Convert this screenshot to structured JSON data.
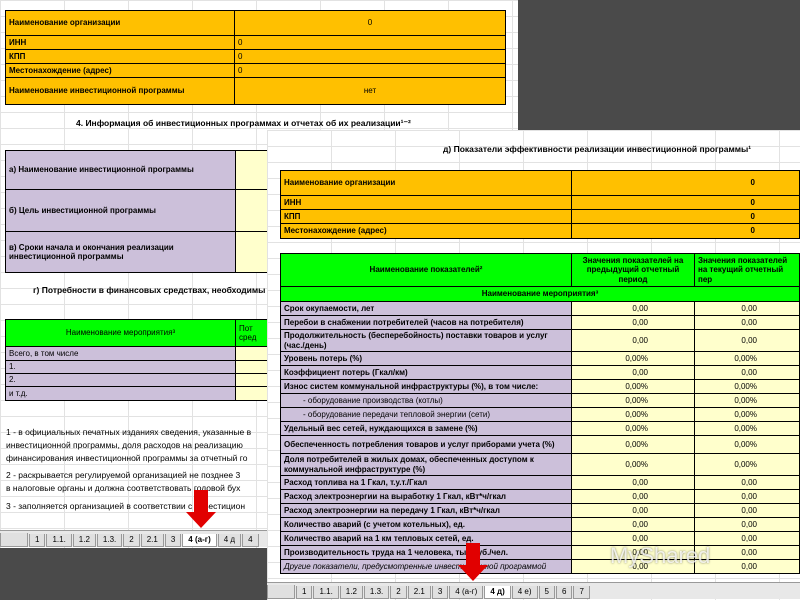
{
  "back": {
    "org_rows": [
      {
        "label": "Наименование организации",
        "value": "0"
      },
      {
        "label": "ИНН",
        "value": "0"
      },
      {
        "label": "КПП",
        "value": "0"
      },
      {
        "label": "Местонахождение (адрес)",
        "value": "0"
      },
      {
        "label": "Наименование инвестиционной программы",
        "value": "нет"
      }
    ],
    "section4_title": "4. Информация об инвестиционных программах и отчетах об их реализации¹⁻²",
    "items": [
      "а) Наименование инвестиционной программы",
      "б) Цель инвестиционной программы",
      "в) Сроки начала и окончания реализации инвестиционной программы"
    ],
    "needs_title": "г) Потребности в финансовых средствах, необходимы",
    "fin_header": "Наименование мероприятия³",
    "fin_header2": "Пот",
    "fin_header3": "сред",
    "fin_rows": [
      "Всего, в том числе",
      "1.",
      "2.",
      "и т.д."
    ],
    "notes": [
      "1 - в официальных печатных изданиях сведения, указанные в",
      "инвестиционной программы, доля расходов на реализацию",
      "финансирования инвестиционной программы за отчетный го",
      "2 - раскрывается регулируемой организацией не позднее 3",
      "в налоговые органы и должна соответствовать годовой бух",
      "3 - заполняется организацией в соответствии с инвестицион"
    ],
    "tabs": [
      "1",
      "1.1.",
      "1.2",
      "1.3.",
      "2",
      "2.1",
      "3",
      "4 (а-г)",
      "4 д",
      "4"
    ],
    "active_tab": "4 (а-г)"
  },
  "front": {
    "title": "д) Показатели эффективности реализации инвестиционной программы¹",
    "org_rows": [
      {
        "label": "Наименование организации",
        "value": "0"
      },
      {
        "label": "ИНН",
        "value": "0"
      },
      {
        "label": "КПП",
        "value": "0"
      },
      {
        "label": "Местонахождение (адрес)",
        "value": "0"
      }
    ],
    "table_headers": [
      "Наименование показателей²",
      "Значения показателей на предыдущий отчетный период",
      "Значения показателей на текущий отчетный пер"
    ],
    "measure_header": "Наименование мероприятия³",
    "rows": [
      {
        "label": "Срок окупаемости, лет",
        "v1": "0,00",
        "v2": "0,00"
      },
      {
        "label": "Перебои в снабжении потребителей (часов на потребителя)",
        "v1": "0,00",
        "v2": "0,00"
      },
      {
        "label": "Продолжительность (бесперебойность) поставки товаров и услуг (час./день)",
        "v1": "0,00",
        "v2": "0,00"
      },
      {
        "label": "Уровень потерь (%)",
        "v1": "0,00%",
        "v2": "0,00%"
      },
      {
        "label": "Коэффициент потерь (Гкал/км)",
        "v1": "0,00",
        "v2": "0,00"
      },
      {
        "label": "Износ систем коммунальной инфраструктуры (%), в том числе:",
        "v1": "0,00%",
        "v2": "0,00%"
      },
      {
        "label": "- оборудование производства (котлы)",
        "v1": "0,00%",
        "v2": "0,00%"
      },
      {
        "label": "- оборудование передачи тепловой энергии (сети)",
        "v1": "0,00%",
        "v2": "0,00%"
      },
      {
        "label": "Удельный вес сетей, нуждающихся в замене (%)",
        "v1": "0,00%",
        "v2": "0,00%"
      },
      {
        "label": "Обеспеченность потребления товаров и услуг приборами учета (%)",
        "v1": "0,00%",
        "v2": "0,00%"
      },
      {
        "label": "Доля потребителей в жилых домах, обеспеченных доступом к коммунальной инфраструктуре (%)",
        "v1": "0,00%",
        "v2": "0,00%"
      },
      {
        "label": "Расход топлива на 1 Гкал, т.у.т./Гкал",
        "v1": "0,00",
        "v2": "0,00"
      },
      {
        "label": "Расход электроэнергии на выработку 1 Гкал, кВт*ч/гкал",
        "v1": "0,00",
        "v2": "0,00"
      },
      {
        "label": "Расход электроэнергии на передачу 1 Гкал, кВт*ч/гкал",
        "v1": "0,00",
        "v2": "0,00"
      },
      {
        "label": "Количество аварий (с учетом котельных), ед.",
        "v1": "0,00",
        "v2": "0,00"
      },
      {
        "label": "Количество аварий на 1 км тепловых сетей, ед.",
        "v1": "0,00",
        "v2": "0,00"
      },
      {
        "label": "Производительность труда на 1 человека, тыс.руб./чел.",
        "v1": "0,00",
        "v2": "0,00"
      },
      {
        "label": "Другие показатели, предусмотренные инвестиционной программой",
        "v1": "0,00",
        "v2": "0,00"
      }
    ],
    "tabs": [
      "1",
      "1.1.",
      "1.2",
      "1.3.",
      "2",
      "2.1",
      "3",
      "4 (а-г)",
      "4 д)",
      "4 е)",
      "5",
      "6",
      "7"
    ],
    "active_tab": "4 д)"
  },
  "watermark": "MyShared",
  "colors": {
    "orange": "#ffc000",
    "green": "#00ff00",
    "lavender": "#ccc0da",
    "arrow": "#e10000"
  }
}
